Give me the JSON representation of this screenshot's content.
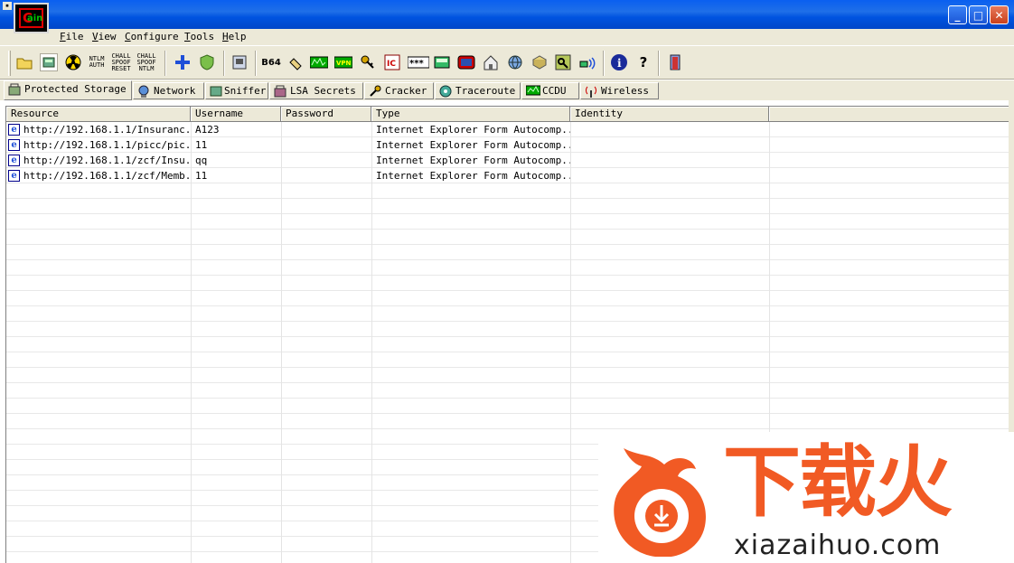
{
  "window": {
    "app_icon_letter": "C",
    "app_icon_sub": "ain",
    "buttons": {
      "minimize": "_",
      "maximize": "□",
      "close": "✕"
    }
  },
  "menu": [
    "File",
    "View",
    "Configure",
    "Tools",
    "Help"
  ],
  "menu_accel": [
    "F",
    "V",
    "C",
    "T",
    "H"
  ],
  "toolbar": {
    "text_icons": {
      "ntlm_auth": [
        "NTLM",
        "AUTH"
      ],
      "chall_spoof_reset": [
        "CHALL",
        "SPOOF",
        "RESET"
      ],
      "chall_spoof_ntlm": [
        "CHALL",
        "SPOOF",
        "NTLM"
      ],
      "b64": "B64",
      "vpn": "VPN",
      "lsa": "***"
    },
    "icons": [
      "open-folder-icon",
      "network-card-icon",
      "poison-icon",
      "ntlm-auth-icon",
      "chall-spoof-reset-icon",
      "chall-spoof-ntlm-icon",
      "add-icon",
      "shield-icon",
      "decoder-icon",
      "base64-icon",
      "hash-icon",
      "rdp-icon",
      "vpn-icon",
      "key-icon",
      "ip-icon",
      "password-icon",
      "calculator-icon",
      "monitor-icon",
      "house-icon",
      "globe-icon",
      "database-icon",
      "lock-icon",
      "wireless-icon",
      "info-icon",
      "help-icon",
      "exit-icon"
    ]
  },
  "tabs": [
    {
      "label": "Protected Storage",
      "active": true
    },
    {
      "label": "Network"
    },
    {
      "label": "Sniffer"
    },
    {
      "label": "LSA Secrets"
    },
    {
      "label": "Cracker"
    },
    {
      "label": "Traceroute"
    },
    {
      "label": "CCDU"
    },
    {
      "label": "Wireless"
    }
  ],
  "table": {
    "columns": [
      "Resource",
      "Username",
      "Password",
      "Type",
      "Identity"
    ],
    "rows": [
      {
        "resource": "http://192.168.1.1/Insuranc...",
        "username": "A123",
        "password": "",
        "type": "Internet Explorer Form Autocomp...",
        "identity": ""
      },
      {
        "resource": "http://192.168.1.1/picc/pic...",
        "username": "11",
        "password": "",
        "type": "Internet Explorer Form Autocomp...",
        "identity": ""
      },
      {
        "resource": "http://192.168.1.1/zcf/Insu...",
        "username": "qq",
        "password": "",
        "type": "Internet Explorer Form Autocomp...",
        "identity": ""
      },
      {
        "resource": "http://192.168.1.1/zcf/Memb...",
        "username": "11",
        "password": "",
        "type": "Internet Explorer Form Autocomp...",
        "identity": ""
      }
    ]
  },
  "watermark": {
    "chinese": "下载火",
    "url": "xiazaihuo.com"
  },
  "colors": {
    "accent": "#0053e0",
    "watermark": "#f15a24",
    "face": "#ece9d8"
  }
}
